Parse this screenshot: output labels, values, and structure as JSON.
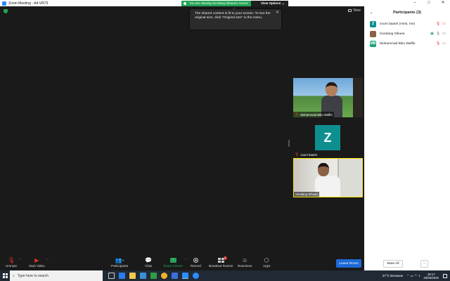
{
  "window": {
    "title": "Zoom Meeting - A4-VR73",
    "min": "–",
    "max": "□",
    "close": "✕"
  },
  "share_banner": {
    "message": "You are viewing Sondang Sibuea's screen",
    "view_options": "View Options ⌄"
  },
  "main": {
    "view_label": "View",
    "tooltip": "The shared content is fit to your screen. To see the original size, click \"Original size\" in the menu.",
    "tooltip_close": "✕"
  },
  "tiles": [
    {
      "name": "Muhammad Biko Waffie",
      "muted": true
    },
    {
      "name": "zoom baa04",
      "initial": "Z",
      "muted": true
    },
    {
      "name": "Sondang Sibuea",
      "muted": false,
      "active_speaker": true
    }
  ],
  "toolbar": {
    "unmute": "Unmute",
    "start_video": "Start Video",
    "participants": "Participants",
    "participants_count": "3",
    "chat": "Chat",
    "share_screen": "Share Screen",
    "record": "Record",
    "breakout_rooms": "Breakout Rooms",
    "breakout_badge": "1",
    "reactions": "Reactions",
    "apps": "Apps",
    "leave": "Leave Room"
  },
  "participants_panel": {
    "title": "Participants (3)",
    "items": [
      {
        "initials": "Z",
        "name": "zoom baa04 (Host, me)",
        "color": "#0e8f8f"
      },
      {
        "initials": "",
        "name": "Sondang Sibuea",
        "color": "#8a6046"
      },
      {
        "initials": "MB",
        "name": "Muhammad Biko Waffie",
        "color": "#1aa37a"
      }
    ],
    "mute_all": "Mute All",
    "more": "..."
  },
  "taskbar": {
    "search_placeholder": "Type here to search",
    "weather": "27°C  Berawan",
    "time": "19:17",
    "date": "23/03/2022"
  },
  "colors": {
    "zoom_green": "#23a455",
    "zoom_blue": "#1e6ad6",
    "muted_red": "#e0312a"
  }
}
